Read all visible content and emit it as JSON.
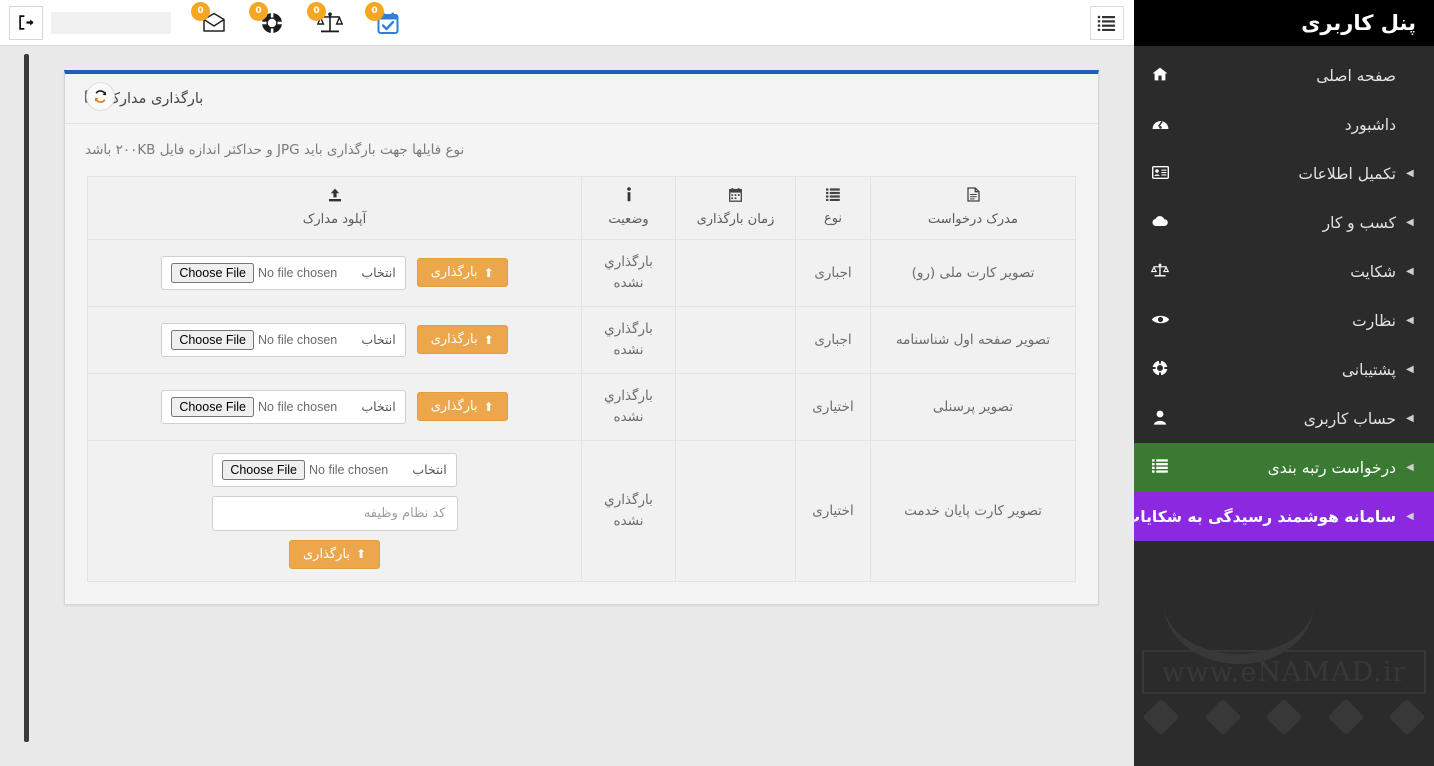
{
  "sidebar": {
    "brand": "پنل کاربری",
    "items": [
      {
        "label": "صفحه اصلی",
        "icon": "home-icon",
        "glyph": "⌂",
        "caret": "",
        "state": "normal"
      },
      {
        "label": "داشبورد",
        "icon": "dashboard-icon",
        "glyph": "◔",
        "caret": "",
        "state": "normal"
      },
      {
        "label": "تکمیل اطلاعات",
        "icon": "id-card-icon",
        "glyph": "▤",
        "caret": "◀",
        "state": "normal"
      },
      {
        "label": "کسب و کار",
        "icon": "cloud-icon",
        "glyph": "☁",
        "caret": "◀",
        "state": "normal"
      },
      {
        "label": "شکایت",
        "icon": "balance-scale-icon",
        "glyph": "⚖",
        "caret": "◀",
        "state": "normal"
      },
      {
        "label": "نظارت",
        "icon": "eye-icon",
        "glyph": "◉",
        "caret": "◀",
        "state": "normal"
      },
      {
        "label": "پشتیبانی",
        "icon": "lifebuoy-icon",
        "glyph": "⊕",
        "caret": "◀",
        "state": "normal"
      },
      {
        "label": "حساب کاربری",
        "icon": "user-icon",
        "glyph": "♟",
        "caret": "◀",
        "state": "normal"
      },
      {
        "label": "درخواست رتبه بندی",
        "icon": "list-icon",
        "glyph": "☰",
        "caret": "◀",
        "state": "green"
      },
      {
        "label": "سامانه هوشمند رسیدگی به شکایات",
        "icon": "balance-scale-icon",
        "glyph": "⚖",
        "caret": "◀",
        "state": "purple"
      }
    ],
    "watermark": "www.eNAMAD.ir",
    "colors": {
      "green": "#3a7a33",
      "purple": "#8c28e0",
      "background": "#2b2b2b",
      "brand_bg": "#000000"
    }
  },
  "topbar": {
    "logout_icon": "logout-icon",
    "menu_toggle_icon": "list-menu-icon",
    "icons": [
      {
        "name": "envelope-icon",
        "badge": "0"
      },
      {
        "name": "lifebuoy-icon",
        "badge": "0"
      },
      {
        "name": "balance-scale-icon",
        "badge": "0"
      },
      {
        "name": "calendar-check-icon",
        "badge": "0"
      }
    ]
  },
  "panel": {
    "title": "بارگذاری مدارک",
    "title_icon": "id-card-icon",
    "refresh_icon": "refresh-icon",
    "accent_color": "#1c5fb5",
    "info_text": "نوع فایلها جهت بارگذاری باید JPG و حداکثر اندازه فایل ۲۰۰KB باشد"
  },
  "table": {
    "headers": [
      {
        "label": "مدرک درخواست",
        "icon": "file-icon",
        "glyph": "὜E"
      },
      {
        "label": "نوع",
        "icon": "list-icon",
        "glyph": "☰"
      },
      {
        "label": "زمان بارگذاری",
        "icon": "calendar-icon",
        "glyph": "Ὄ5"
      },
      {
        "label": "وضعیت",
        "icon": "info-icon",
        "glyph": "i"
      },
      {
        "label": "آپلود مدارک",
        "icon": "upload-icon",
        "glyph": "⬆"
      }
    ],
    "rows": [
      {
        "document": "تصویر کارت ملی (رو)",
        "type": "اجباری",
        "time": "",
        "status": "بارگذاري نشده",
        "file_label": "انتخاب",
        "upload_button": "بارگذاری",
        "extra_input": null,
        "layout": "inline"
      },
      {
        "document": "تصویر صفحه اول شناسنامه",
        "type": "اجباری",
        "time": "",
        "status": "بارگذاري نشده",
        "file_label": "انتخاب",
        "upload_button": "بارگذاری",
        "extra_input": null,
        "layout": "inline"
      },
      {
        "document": "تصویر پرسنلی",
        "type": "اختیاری",
        "time": "",
        "status": "بارگذاري نشده",
        "file_label": "انتخاب",
        "upload_button": "بارگذاری",
        "extra_input": null,
        "layout": "inline"
      },
      {
        "document": "تصویر کارت پایان خدمت",
        "type": "اختیاری",
        "time": "",
        "status": "بارگذاري نشده",
        "file_label": "انتخاب",
        "upload_button": "بارگذاری",
        "extra_input": {
          "placeholder": "کد نظام وظیفه",
          "value": ""
        },
        "layout": "stacked"
      }
    ]
  }
}
